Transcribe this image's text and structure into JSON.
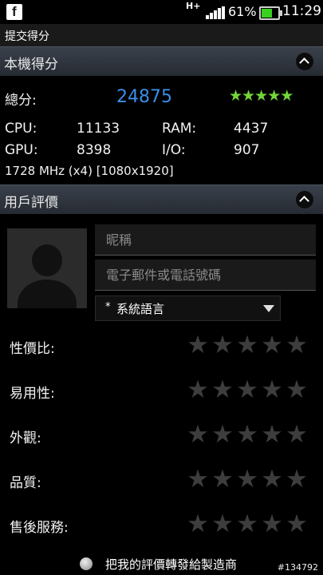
{
  "status_bar": {
    "notification_icon": "facebook-icon",
    "network": "H+",
    "battery_percent": "61%",
    "battery_level": 0.61,
    "time": "11:29"
  },
  "title": "提交得分",
  "score_section": {
    "header": "本機得分",
    "total_label": "總分:",
    "total_value": "24875",
    "star_rating": 5,
    "cpu_label": "CPU:",
    "cpu_value": "11133",
    "ram_label": "RAM:",
    "ram_value": "4437",
    "gpu_label": "GPU:",
    "gpu_value": "8398",
    "io_label": "I/O:",
    "io_value": "907",
    "device_spec": "1728 MHz (x4) [1080x1920]"
  },
  "review_section": {
    "header": "用戶評價",
    "nickname_placeholder": "昵稱",
    "contact_placeholder": "電子郵件或電話號碼",
    "language_required": "*",
    "language_value": "系統語言",
    "ratings": [
      {
        "label": "性價比:",
        "value": 0
      },
      {
        "label": "易用性:",
        "value": 0
      },
      {
        "label": "外觀:",
        "value": 0
      },
      {
        "label": "品質:",
        "value": 0
      },
      {
        "label": "售後服務:",
        "value": 0
      }
    ],
    "forward_label": "把我的評價轉發給製造商"
  },
  "image_id": "#134792",
  "colors": {
    "accent": "#3a8ee6",
    "star_filled": "#74d63a",
    "star_empty": "#3d3d3d",
    "battery": "#39d11f"
  }
}
